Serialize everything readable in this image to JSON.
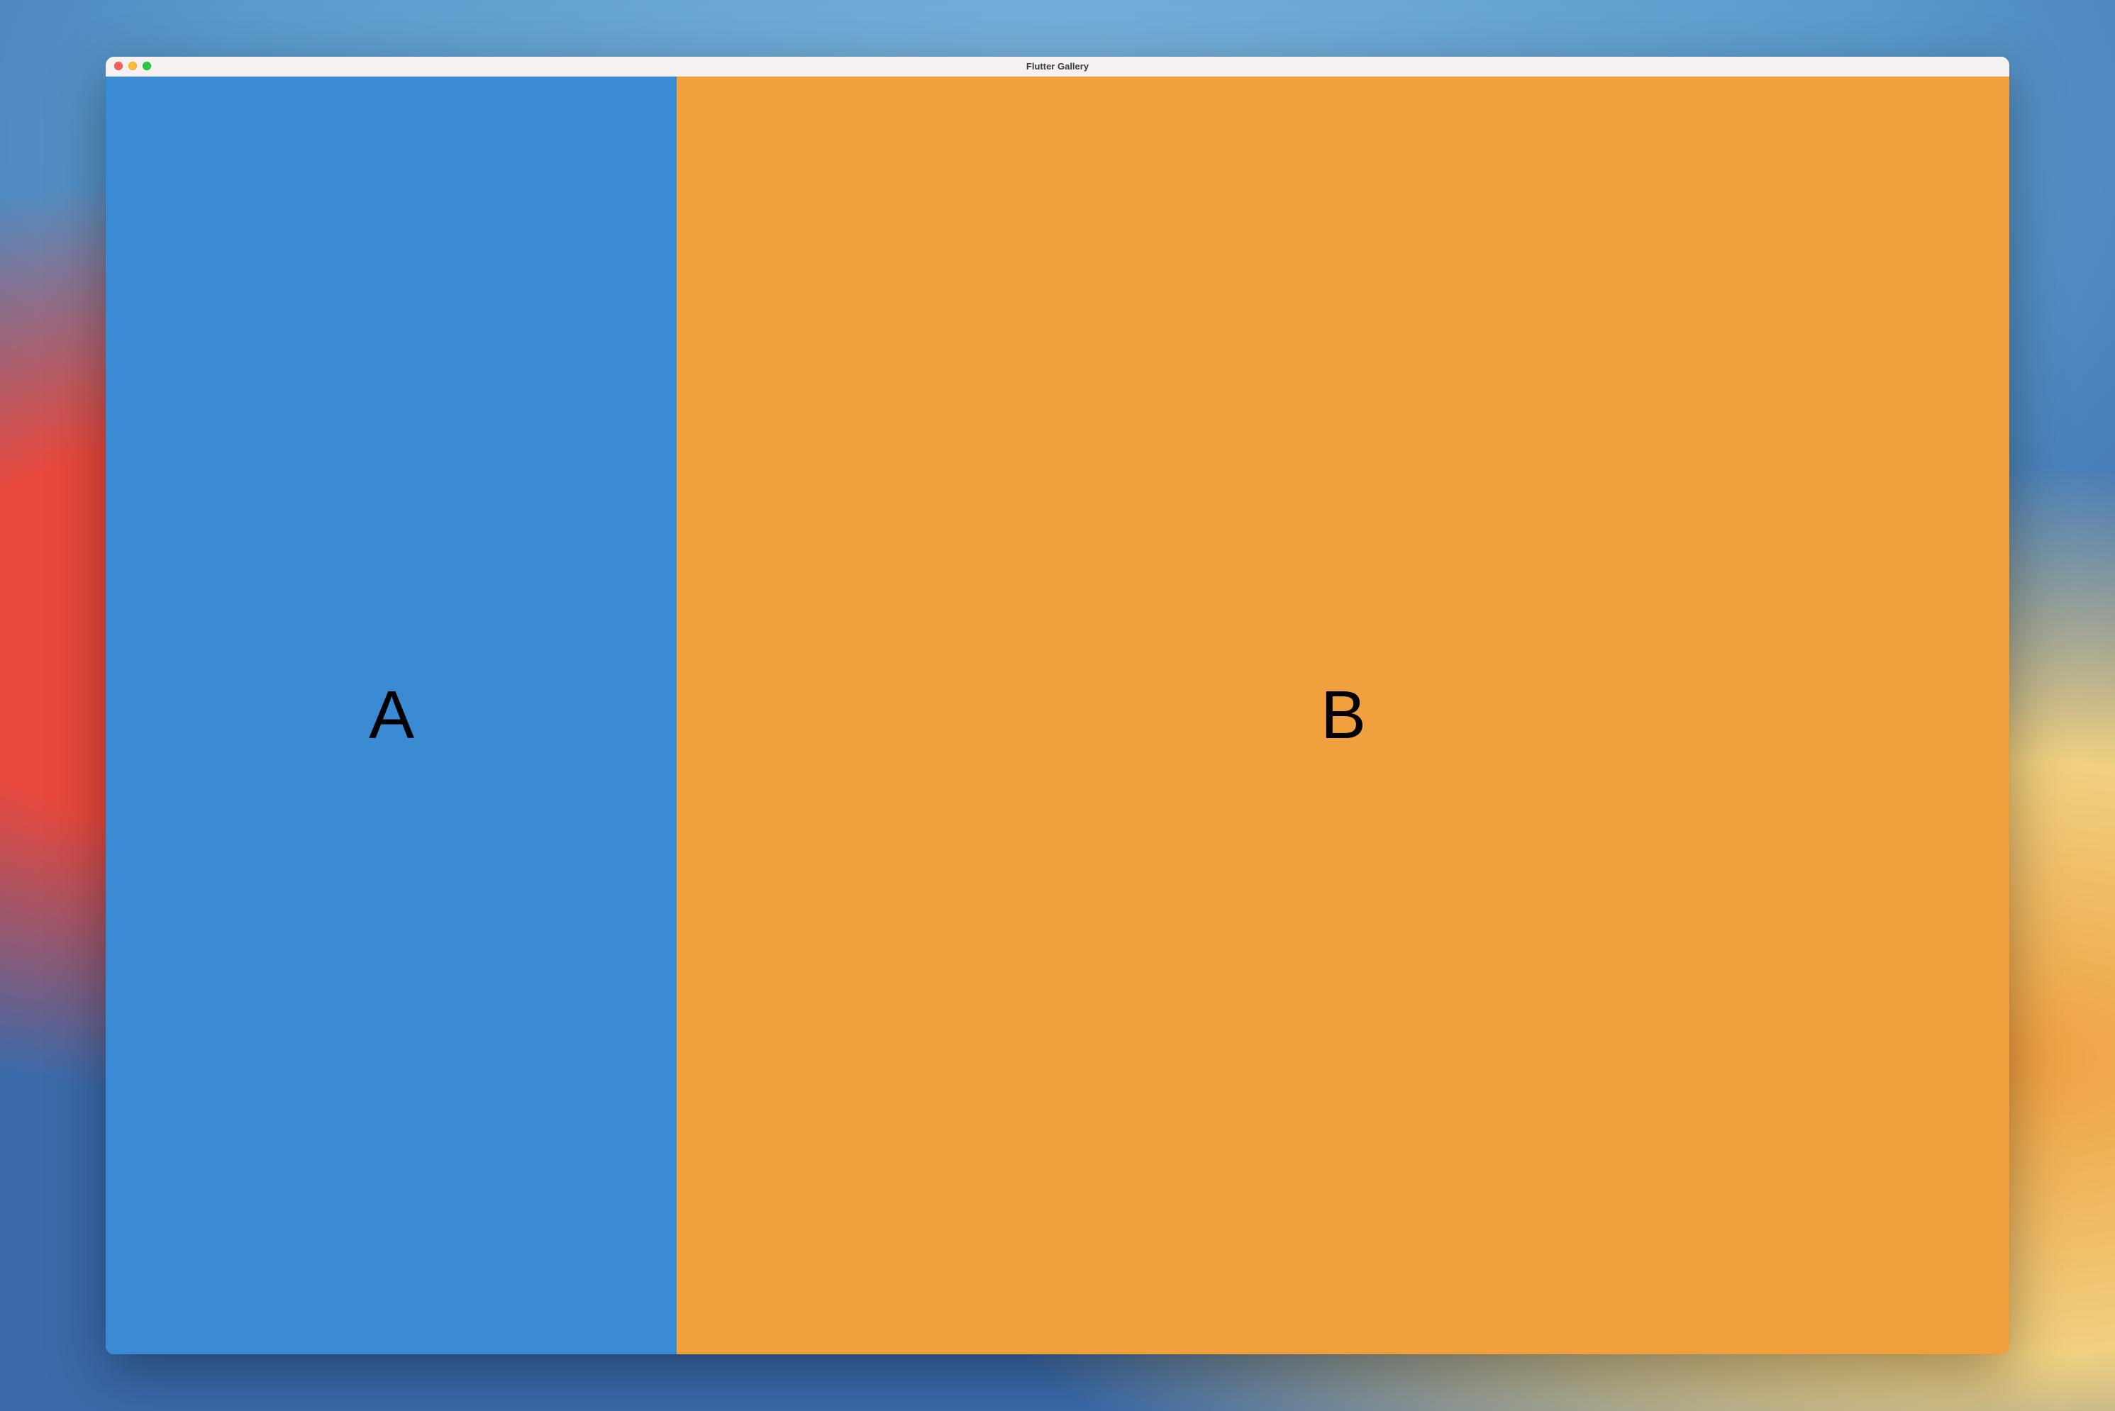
{
  "window": {
    "title": "Flutter Gallery"
  },
  "panels": {
    "a": {
      "label": "A",
      "color": "#3b8bd4"
    },
    "b": {
      "label": "B",
      "color": "#f0a03c"
    }
  }
}
